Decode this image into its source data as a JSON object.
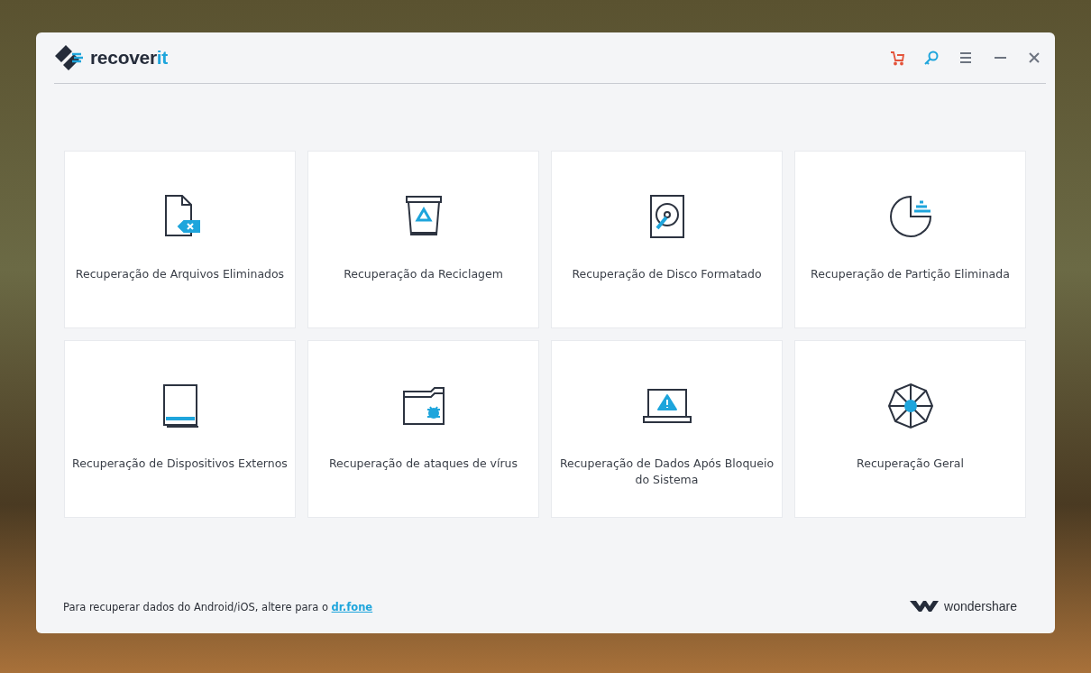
{
  "logo": {
    "main": "recover",
    "accent": "it"
  },
  "cards": [
    {
      "label": "Recuperação de Arquivos Eliminados"
    },
    {
      "label": "Recuperação da Reciclagem"
    },
    {
      "label": "Recuperação de Disco Formatado"
    },
    {
      "label": "Recuperação de Partição Eliminada"
    },
    {
      "label": "Recuperação de Dispositivos Externos"
    },
    {
      "label": "Recuperação de ataques de vírus"
    },
    {
      "label": "Recuperação de Dados Após Bloqueio do Sistema"
    },
    {
      "label": "Recuperação Geral"
    }
  ],
  "footer": {
    "text": "Para recuperar dados do Android/iOS, altere para o",
    "link": "dr.fone",
    "brand": "wondershare"
  }
}
